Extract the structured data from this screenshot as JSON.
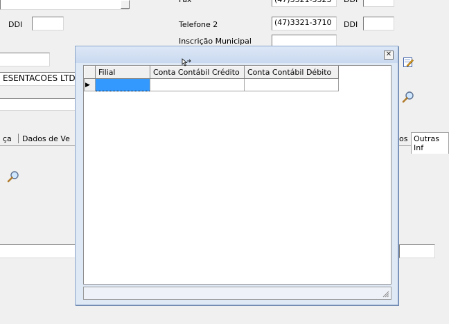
{
  "form": {
    "ddi_label_1": "DDI",
    "ddi_label_2": "DDI",
    "ddi_label_3": "DDI",
    "fax_label": "Fax",
    "fax_value": "(47)3321-3323",
    "telefone2_label": "Telefone 2",
    "telefone2_value": "(47)3321-3710",
    "inscricao_label": "Inscrição Municipal",
    "company_name": "ESENTACOES LTD",
    "tabs": [
      "ça",
      "Dados de Ve",
      "os",
      "Outras Inf"
    ]
  },
  "dialog": {
    "close_glyph": "✕",
    "columns": [
      "Filial",
      "Conta Contábil Crédito",
      "Conta Contábil Débito"
    ],
    "rows": [
      [
        "",
        "",
        ""
      ]
    ],
    "current_row_marker": "▶"
  },
  "colors": {
    "selected_cell": "#3399ff",
    "dialog_bg": "#dfe8f5"
  }
}
